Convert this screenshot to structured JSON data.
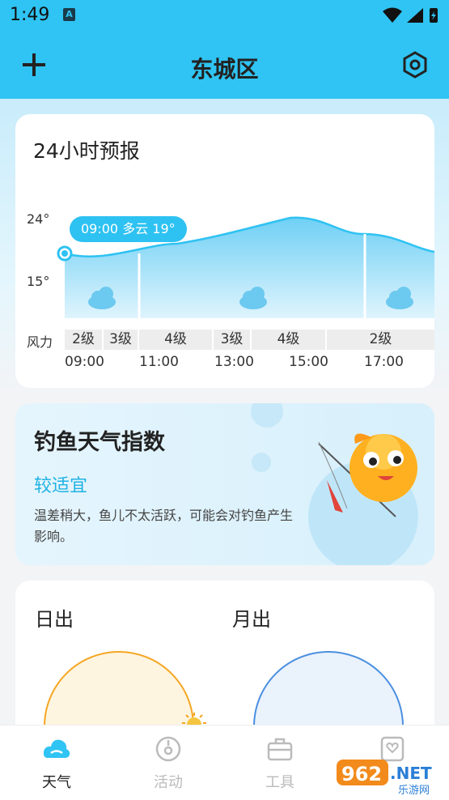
{
  "status_bar": {
    "time": "1:49",
    "badge": "A"
  },
  "header": {
    "title": "东城区",
    "add_icon": "plus-icon",
    "settings_icon": "hexagon-settings-icon"
  },
  "forecast": {
    "title": "24小时预报",
    "y_labels": [
      "24°",
      "15°"
    ],
    "tooltip": "09:00 多云 19°",
    "wind_label": "风力",
    "wind_levels": [
      "2级",
      "3级",
      "4级",
      "3级",
      "4级",
      "2级"
    ],
    "hours": [
      "09:00",
      "11:00",
      "13:00",
      "15:00",
      "17:00"
    ],
    "weather_icon": "cloud-icon"
  },
  "fishing": {
    "title": "钓鱼天气指数",
    "level": "较适宜",
    "description": "温差稍大，鱼儿不太活跃，可能会对钓鱼产生影响。"
  },
  "sun_moon": {
    "sunrise_label": "日出",
    "moonrise_label": "月出"
  },
  "nav": {
    "items": [
      {
        "label": "天气",
        "icon": "weather-cloud-icon",
        "active": true
      },
      {
        "label": "活动",
        "icon": "compass-icon",
        "active": false
      },
      {
        "label": "工具",
        "icon": "toolbox-icon",
        "active": false
      },
      {
        "label": "",
        "icon": "heart-icon",
        "active": false
      }
    ]
  },
  "watermark": {
    "text": "962.NET",
    "subtext": "乐游网"
  },
  "colors": {
    "accent": "#2fc4f3",
    "text": "#222222",
    "sun": "#f5a623",
    "moon": "#4a8fe0"
  }
}
